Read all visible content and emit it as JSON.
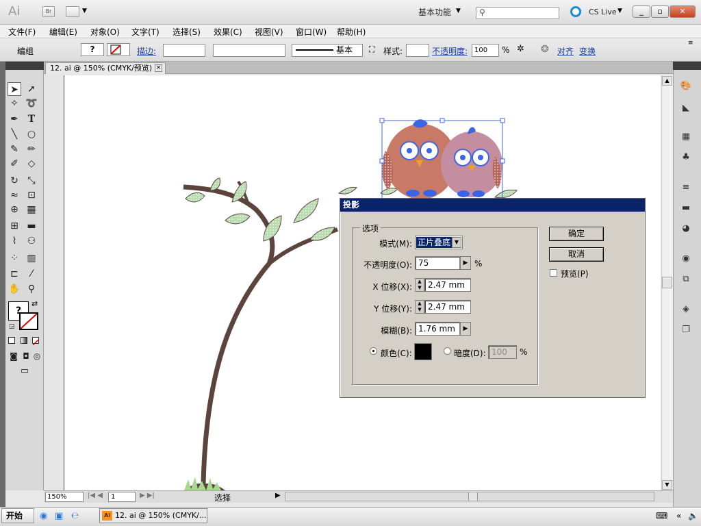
{
  "app": {
    "logo": "Ai",
    "bridge": "Br",
    "workspace": "基本功能",
    "search_placeholder": "",
    "cslive": "CS Live"
  },
  "window_controls": {
    "minimize": "_",
    "restore": "▫",
    "close": "✕"
  },
  "menu": [
    "文件(F)",
    "编辑(E)",
    "对象(O)",
    "文字(T)",
    "选择(S)",
    "效果(C)",
    "视图(V)",
    "窗口(W)",
    "帮助(H)"
  ],
  "control": {
    "selection": "编组",
    "stroke_label": "描边:",
    "stroke_style": "基本",
    "style_label": "样式:",
    "opacity_label": "不透明度:",
    "opacity": "100",
    "opacity_unit": "%",
    "align_label": "对齐",
    "transform_label": "变换"
  },
  "document": {
    "tab": "12. ai @ 150% (CMYK/预览)"
  },
  "status": {
    "zoom": "150%",
    "page": "1",
    "selection": "选择"
  },
  "dialog": {
    "title": "投影",
    "group_label": "选项",
    "mode_label": "模式(M):",
    "mode_value": "正片叠底",
    "opacity_label": "不透明度(O):",
    "opacity_value": "75",
    "opacity_unit": "%",
    "x_label": "X 位移(X):",
    "x_value": "2.47 mm",
    "y_label": "Y 位移(Y):",
    "y_value": "2.47 mm",
    "blur_label": "模糊(B):",
    "blur_value": "1.76 mm",
    "color_label": "颜色(C):",
    "darkness_label": "暗度(D):",
    "darkness_value": "100",
    "darkness_unit": "%",
    "ok": "确定",
    "cancel": "取消",
    "preview": "预览(P)"
  },
  "taskbar": {
    "start": "开始",
    "task": "12. ai @ 150% (CMYK/..."
  },
  "colors": {
    "title_bar": "#0a246a",
    "tree": "#5a443c",
    "leaf": "#b8dcb0",
    "selection": "#3a66e6"
  }
}
